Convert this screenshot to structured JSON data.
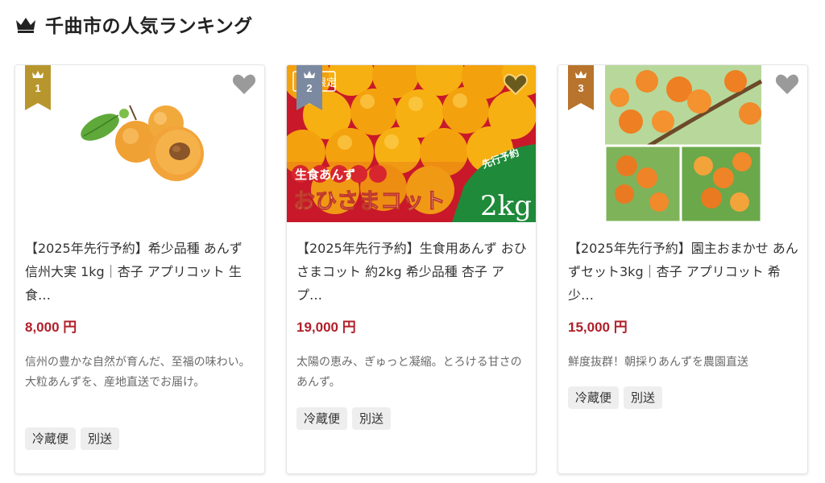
{
  "header": {
    "title": "千曲市の人気ランキング"
  },
  "colors": {
    "price": "#b0202a",
    "rank1": "#b8962e",
    "rank2": "#7b8aa0",
    "rank3": "#b8742c"
  },
  "items": [
    {
      "rank": "1",
      "image": "apricot-halves-photo",
      "title": "【2025年先行予約】希少品種 あんず 信州大実 1kg｜杏子 アプリコット 生食…",
      "price": "8,000 円",
      "description": "信州の豊かな自然が育んだ、至福の味わい。大粒あんずを、産地直送でお届け。",
      "tags": [
        "冷蔵便",
        "別送"
      ]
    },
    {
      "rank": "2",
      "image": "apricots-box-photo",
      "image_badge": "限定",
      "image_texts": [
        "生食あんず",
        "おひさまコット",
        "先行予約",
        "2kg"
      ],
      "title": "【2025年先行予約】生食用あんず おひさまコット 約2kg 希少品種 杏子 アプ…",
      "price": "19,000 円",
      "description": "太陽の恵み、ぎゅっと凝縮。とろける甘さのあんず。",
      "tags": [
        "冷蔵便",
        "別送"
      ]
    },
    {
      "rank": "3",
      "image": "apricot-tree-collage-photo",
      "title": "【2025年先行予約】園主おまかせ あんずセット3kg｜杏子 アプリコット 希少…",
      "price": "15,000 円",
      "description": "鮮度抜群！朝採りあんずを農園直送",
      "tags": [
        "冷蔵便",
        "別送"
      ]
    }
  ]
}
